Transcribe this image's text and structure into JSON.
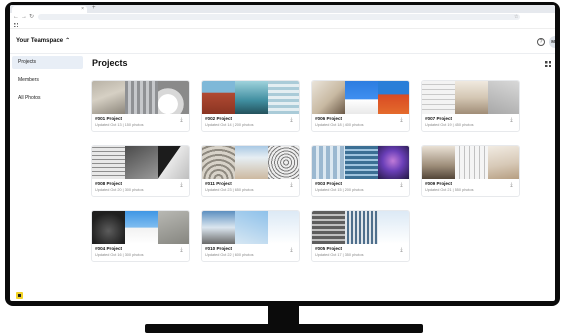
{
  "browser": {
    "tab_close": "×",
    "new_tab": "+",
    "back": "←",
    "forward": "→",
    "reload": "↻",
    "bookmark_star": "☆"
  },
  "header": {
    "team_name": "Your Teamspace",
    "team_chevron": "⌃",
    "help": "?",
    "avatar_initials": "MM"
  },
  "sidebar": {
    "items": [
      {
        "label": "Projects"
      },
      {
        "label": "Members"
      },
      {
        "label": "All Photos"
      }
    ]
  },
  "main": {
    "title": "Projects",
    "download_glyph": "⤓",
    "projects": [
      {
        "name": "#001 Project",
        "meta": "Updated Oct 13 | 150 photos"
      },
      {
        "name": "#002 Project",
        "meta": "Updated Oct 14 | 200 photos"
      },
      {
        "name": "#006 Project",
        "meta": "Updated Oct 18 | 400 photos"
      },
      {
        "name": "#007 Project",
        "meta": "Updated Oct 19 | 450 photos"
      },
      {
        "name": "#008 Project",
        "meta": "Updated Oct 20 | 300 photos"
      },
      {
        "name": "#011 Project",
        "meta": "Updated Oct 23 | 650 photos"
      },
      {
        "name": "#003 Project",
        "meta": "Updated Oct 15 | 200 photos"
      },
      {
        "name": "#009 Project",
        "meta": "Updated Oct 21 | 550 photos"
      },
      {
        "name": "#004 Project",
        "meta": "Updated Oct 16 | 300 photos"
      },
      {
        "name": "#010 Project",
        "meta": "Updated Oct 22 | 600 photos"
      },
      {
        "name": "#005 Project",
        "meta": "Updated Oct 17 | 350 photos"
      }
    ]
  },
  "colors": {
    "active_nav_bg": "#e8eef6",
    "brand_yellow": "#f3d428",
    "monitor_bezel": "#0b0b0b"
  }
}
